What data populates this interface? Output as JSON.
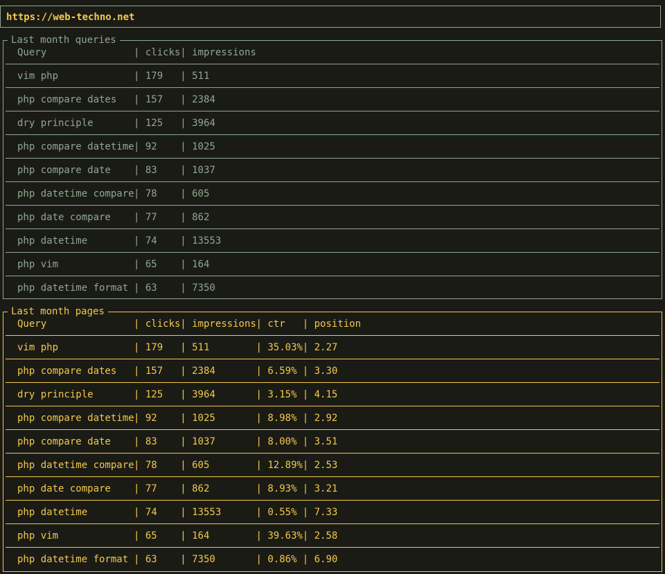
{
  "url": "https://web-techno.net",
  "queries": {
    "title": "Last month queries",
    "columns": [
      "Query",
      "clicks",
      "impressions"
    ],
    "rows": [
      [
        "vim php",
        "179",
        "511"
      ],
      [
        "php compare dates",
        "157",
        "2384"
      ],
      [
        "dry principle",
        "125",
        "3964"
      ],
      [
        "php compare datetime",
        "92",
        "1025"
      ],
      [
        "php compare date",
        "83",
        "1037"
      ],
      [
        "php datetime compare",
        "78",
        "605"
      ],
      [
        "php date compare",
        "77",
        "862"
      ],
      [
        "php datetime",
        "74",
        "13553"
      ],
      [
        "php vim",
        "65",
        "164"
      ],
      [
        "php datetime format",
        "63",
        "7350"
      ]
    ]
  },
  "pages": {
    "title": "Last month pages",
    "columns": [
      "Query",
      "clicks",
      "impressions",
      "ctr",
      "position"
    ],
    "rows": [
      [
        "vim php",
        "179",
        "511",
        "35.03%",
        "2.27"
      ],
      [
        "php compare dates",
        "157",
        "2384",
        "6.59%",
        "3.30"
      ],
      [
        "dry principle",
        "125",
        "3964",
        "3.15%",
        "4.15"
      ],
      [
        "php compare datetime",
        "92",
        "1025",
        "8.98%",
        "2.92"
      ],
      [
        "php compare date",
        "83",
        "1037",
        "8.00%",
        "3.51"
      ],
      [
        "php datetime compare",
        "78",
        "605",
        "12.89%",
        "2.53"
      ],
      [
        "php date compare",
        "77",
        "862",
        "8.93%",
        "3.21"
      ],
      [
        "php datetime",
        "74",
        "13553",
        "0.55%",
        "7.33"
      ],
      [
        "php vim",
        "65",
        "164",
        "39.63%",
        "2.58"
      ],
      [
        "php datetime format",
        "63",
        "7350",
        "0.86%",
        "6.90"
      ]
    ]
  }
}
